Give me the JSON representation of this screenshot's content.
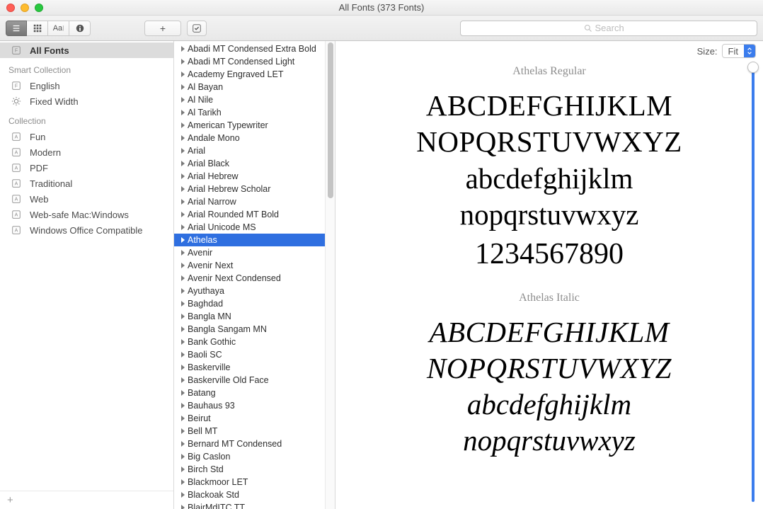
{
  "window": {
    "title": "All Fonts (373 Fonts)"
  },
  "toolbar": {
    "add_tooltip": "+",
    "check_tooltip": "✓",
    "search_placeholder": "Search"
  },
  "sidebar": {
    "all_fonts_label": "All Fonts",
    "smart_collection_header": "Smart Collection",
    "collection_header": "Collection",
    "smart_collections": [
      {
        "label": "English",
        "icon": "F"
      },
      {
        "label": "Fixed Width",
        "icon": "gear"
      }
    ],
    "collections": [
      {
        "label": "Fun"
      },
      {
        "label": "Modern"
      },
      {
        "label": "PDF"
      },
      {
        "label": "Traditional"
      },
      {
        "label": "Web"
      },
      {
        "label": "Web-safe Mac:Windows"
      },
      {
        "label": "Windows Office Compatible"
      }
    ]
  },
  "fonts": [
    "Abadi MT Condensed Extra Bold",
    "Abadi MT Condensed Light",
    "Academy Engraved LET",
    "Al Bayan",
    "Al Nile",
    "Al Tarikh",
    "American Typewriter",
    "Andale Mono",
    "Arial",
    "Arial Black",
    "Arial Hebrew",
    "Arial Hebrew Scholar",
    "Arial Narrow",
    "Arial Rounded MT Bold",
    "Arial Unicode MS",
    "Athelas",
    "Avenir",
    "Avenir Next",
    "Avenir Next Condensed",
    "Ayuthaya",
    "Baghdad",
    "Bangla MN",
    "Bangla Sangam MN",
    "Bank Gothic",
    "Baoli SC",
    "Baskerville",
    "Baskerville Old Face",
    "Batang",
    "Bauhaus 93",
    "Beirut",
    "Bell MT",
    "Bernard MT Condensed",
    "Big Caslon",
    "Birch Std",
    "Blackmoor LET",
    "Blackoak Std",
    "BlairMdITC TT"
  ],
  "selected_font": "Athelas",
  "preview": {
    "size_label": "Size:",
    "size_value": "Fit",
    "samples": [
      {
        "title": "Athelas Regular",
        "upper1": "ABCDEFGHIJKLM",
        "upper2": "NOPQRSTUVWXYZ",
        "lower1": "abcdefghijklm",
        "lower2": "nopqrstuvwxyz",
        "numbers": "1234567890"
      },
      {
        "title": "Athelas Italic",
        "upper1": "ABCDEFGHIJKLM",
        "upper2": "NOPQRSTUVWXYZ",
        "lower1": "abcdefghijklm",
        "lower2": "nopqrstuvwxyz"
      }
    ]
  }
}
